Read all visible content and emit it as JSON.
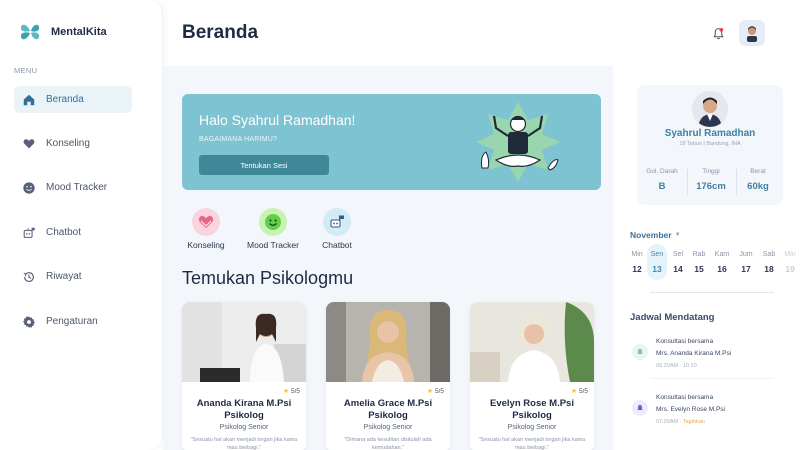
{
  "app": {
    "name": "MentalKita"
  },
  "sidebar": {
    "menu_label": "MENU",
    "items": [
      {
        "label": "Beranda",
        "icon": "home-icon",
        "active": true
      },
      {
        "label": "Konseling",
        "icon": "heart-hands-icon"
      },
      {
        "label": "Mood Tracker",
        "icon": "mood-face-icon"
      },
      {
        "label": "Chatbot",
        "icon": "robot-icon"
      },
      {
        "label": "Riwayat",
        "icon": "history-icon"
      },
      {
        "label": "Pengaturan",
        "icon": "gear-icon"
      }
    ]
  },
  "header": {
    "title": "Beranda",
    "notification_icon": "bell-icon",
    "avatar_icon": "user-avatar"
  },
  "banner": {
    "greeting": "Halo Syahrul Ramadhan!",
    "subtitle": "BAGAIMANA HARIMU?",
    "button_label": "Tentukan Sesi"
  },
  "quick_actions": [
    {
      "label": "Konseling",
      "icon": "heart-icon",
      "color": "#f7c9d4"
    },
    {
      "label": "Mood Tracker",
      "icon": "smile-icon",
      "color": "#bff0a8"
    },
    {
      "label": "Chatbot",
      "icon": "chatbot-icon",
      "color": "#cfe9f3"
    }
  ],
  "psychologists": {
    "section_title": "Temukan Psikologmu",
    "cards": [
      {
        "name": "Ananda Kirana M.Psi",
        "title": "Psikolog",
        "role": "Psikolog Senior",
        "rating": "5/5",
        "quote": "\"Sesuatu hal akan menjadi ringan jika kamu mau berbagi.\""
      },
      {
        "name": "Amelia Grace M.Psi",
        "title": "Psikolog",
        "role": "Psikolog Senior",
        "rating": "5/5",
        "quote": "\"Dimana ada kesulitan disitulah ada kemudahan.\""
      },
      {
        "name": "Evelyn Rose M.Psi",
        "title": "Psikolog",
        "role": "Psikolog Senior",
        "rating": "5/5",
        "quote": "\"Sesuatu hal akan menjadi ringan jika kamu mau berbagi.\""
      }
    ]
  },
  "profile": {
    "name": "Syahrul Ramadhan",
    "meta": "19 Tahun  |  Bandung, INA",
    "stats": [
      {
        "label": "Gol. Darah",
        "value": "B"
      },
      {
        "label": "Tinggi",
        "value": "176cm"
      },
      {
        "label": "Berat",
        "value": "60kg"
      }
    ]
  },
  "calendar": {
    "month": "November",
    "days": [
      {
        "dow": "Min",
        "num": "12"
      },
      {
        "dow": "Sen",
        "num": "13",
        "active": true
      },
      {
        "dow": "Sel",
        "num": "14"
      },
      {
        "dow": "Rab",
        "num": "15"
      },
      {
        "dow": "Kam",
        "num": "16"
      },
      {
        "dow": "Jum",
        "num": "17"
      },
      {
        "dow": "Sab",
        "num": "18"
      },
      {
        "dow": "Min",
        "num": "19",
        "faded": true
      }
    ]
  },
  "schedule": {
    "title": "Jadwal Mendatang",
    "items": [
      {
        "line1": "Konsultasi bersama",
        "line2": "Mrs. Ananda Kirana M.Psi",
        "time": "09.20AM - 10.10",
        "status": "",
        "color": "#6ccf8f",
        "bg": "#e7f7ec"
      },
      {
        "line1": "Konsultasi bersama",
        "line2": "Mrs. Evelyn Rose M.Psi",
        "time": "07.00AM",
        "status": "Tagihkan",
        "color": "#7b5cd6",
        "bg": "#efeafb"
      }
    ]
  }
}
